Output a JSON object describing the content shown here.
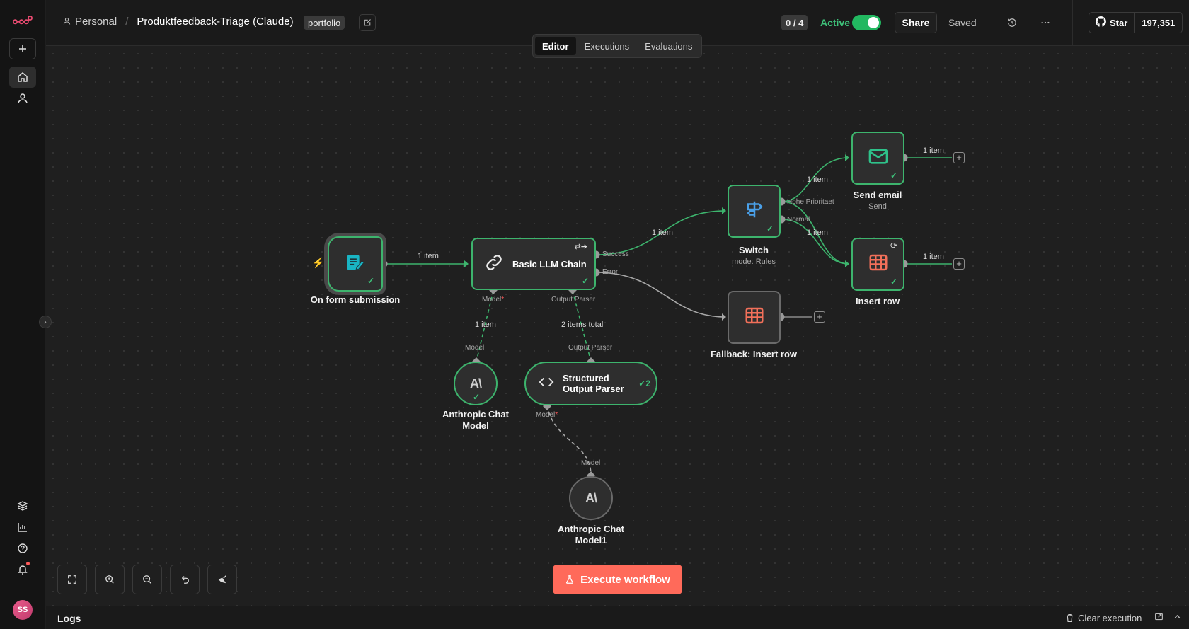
{
  "header": {
    "workspace": "Personal",
    "separator": "/",
    "workflow_name": "Produktfeedback-Triage (Claude)",
    "tag": "portfolio",
    "counter": "0 / 4",
    "active_label": "Active",
    "share_label": "Share",
    "saved_label": "Saved",
    "github_star_label": "Star",
    "github_star_count": "197,351"
  },
  "tabs": [
    {
      "label": "Editor",
      "active": true
    },
    {
      "label": "Executions",
      "active": false
    },
    {
      "label": "Evaluations",
      "active": false
    }
  ],
  "nodes": {
    "form": {
      "label": "On form submission"
    },
    "llm": {
      "label": "Basic LLM Chain"
    },
    "switch": {
      "label": "Switch",
      "sub": "mode: Rules"
    },
    "email": {
      "label": "Send email",
      "sub": "Send"
    },
    "insert": {
      "label": "Insert row"
    },
    "fallback": {
      "label": "Fallback: Insert row"
    },
    "anthropic1": {
      "label_line1": "Anthropic Chat",
      "label_line2": "Model"
    },
    "parser": {
      "label_line1": "Structured",
      "label_line2": "Output Parser",
      "count": "2"
    },
    "anthropic2": {
      "label_line1": "Anthropic Chat",
      "label_line2": "Model1"
    }
  },
  "ports": {
    "success": "Success",
    "error": "Error",
    "model_required": "Model",
    "required_mark": "*",
    "output_parser": "Output Parser",
    "model": "Model",
    "hohe_prioritaet": "Hohe Prioritaet",
    "normal": "Normal"
  },
  "edges": {
    "form_llm": "1 item",
    "llm_switch": "1 item",
    "switch_email": "1 item",
    "switch_insert": "1 item",
    "email_out": "1 item",
    "insert_out": "1 item",
    "model_conn": "1 item",
    "parser_conn": "2 items total"
  },
  "execute_label": "Execute workflow",
  "logs": {
    "title": "Logs",
    "clear_label": "Clear execution"
  },
  "user_initials": "SS",
  "colors": {
    "accent": "#ff6a5a",
    "success": "#3db46d",
    "brand": "#ea4b71"
  }
}
